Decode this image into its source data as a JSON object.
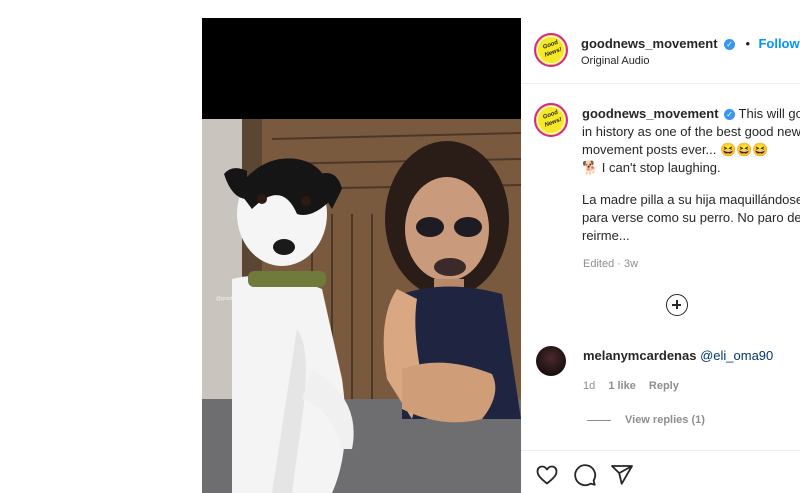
{
  "post": {
    "watermark": "@goodnews_movement",
    "author": {
      "username": "goodnews_movement",
      "verified_mark": "✓",
      "separator": "•",
      "follow_label": "Follow",
      "audio": "Original Audio",
      "avatar_text": "Good News!"
    },
    "caption": {
      "text_en": "This will go down in history as one of the best good news movement posts ever... 😆😆😆\n🐕 I can't stop laughing.",
      "text_es": "La madre pilla a su hija maquillándose para verse como su perro. No paro de reirme...",
      "edited": "Edited · 3w"
    },
    "icons": {
      "load_more": "plus-circle-icon",
      "like": "heart-icon",
      "comment": "comment-icon",
      "share": "share-icon",
      "verified": "verified-badge-icon"
    },
    "comments": [
      {
        "username": "melanymcardenas",
        "text": "@eli_oma90",
        "time": "1d",
        "likes": "1 like",
        "reply_label": "Reply",
        "view_replies": "View replies (1)"
      }
    ],
    "colors": {
      "accent": "#0095f6",
      "avatar_bg": "#f7e826",
      "ring": "#d6249f"
    }
  }
}
